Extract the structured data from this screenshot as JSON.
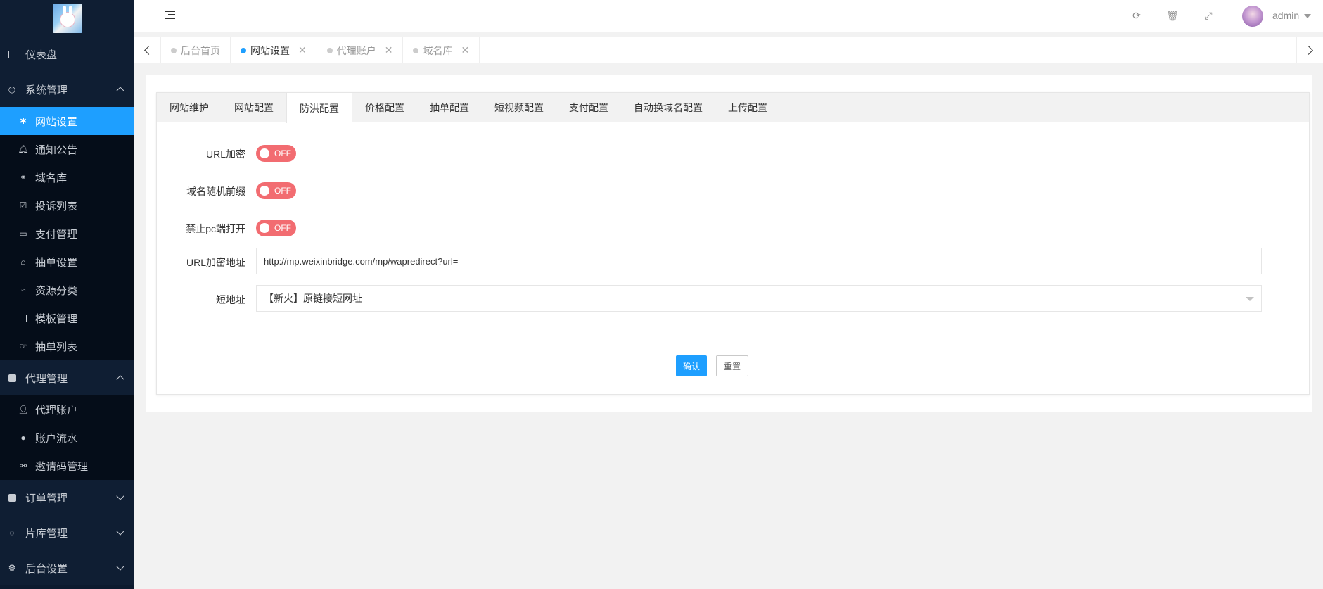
{
  "sidebar": {
    "logo_alt": "logo",
    "groups": [
      {
        "label": "仪表盘",
        "icon": "dashboard-icon",
        "children": []
      },
      {
        "label": "系统管理",
        "icon": "settings-icon",
        "expanded": true,
        "children": [
          {
            "label": "网站设置",
            "icon": "asterisk-icon",
            "active": true
          },
          {
            "label": "通知公告",
            "icon": "bell-icon"
          },
          {
            "label": "域名库",
            "icon": "link-icon"
          },
          {
            "label": "投诉列表",
            "icon": "checkbox-icon"
          },
          {
            "label": "支付管理",
            "icon": "credit-card-icon"
          },
          {
            "label": "抽单设置",
            "icon": "industry-icon"
          },
          {
            "label": "资源分类",
            "icon": "swimmer-icon"
          },
          {
            "label": "模板管理",
            "icon": "html5-icon"
          },
          {
            "label": "抽单列表",
            "icon": "hand-lizard-icon"
          }
        ]
      },
      {
        "label": "代理管理",
        "icon": "address-book-icon",
        "expanded": true,
        "children": [
          {
            "label": "代理账户",
            "icon": "user-icon"
          },
          {
            "label": "账户流水",
            "icon": "money-circle-icon"
          },
          {
            "label": "邀请码管理",
            "icon": "handshake-icon"
          }
        ]
      },
      {
        "label": "订单管理",
        "icon": "order-icon",
        "expanded": false,
        "children": []
      },
      {
        "label": "片库管理",
        "icon": "film-icon",
        "expanded": false,
        "children": []
      },
      {
        "label": "后台设置",
        "icon": "cogs-icon",
        "expanded": false,
        "children": []
      }
    ]
  },
  "header": {
    "user_name": "admin"
  },
  "page_tabs": [
    {
      "label": "后台首页",
      "active": false,
      "closable": false
    },
    {
      "label": "网站设置",
      "active": true,
      "closable": true
    },
    {
      "label": "代理账户",
      "active": false,
      "closable": true
    },
    {
      "label": "域名库",
      "active": false,
      "closable": true
    }
  ],
  "form_tabs": [
    "网站维护",
    "网站配置",
    "防洪配置",
    "价格配置",
    "抽单配置",
    "短视频配置",
    "支付配置",
    "自动换域名配置",
    "上传配置"
  ],
  "active_form_tab": "防洪配置",
  "form": {
    "url_encrypt": {
      "label": "URL加密",
      "state": "OFF"
    },
    "domain_random_prefix": {
      "label": "域名随机前缀",
      "state": "OFF"
    },
    "block_pc": {
      "label": "禁止pc端打开",
      "state": "OFF"
    },
    "url_encrypt_address": {
      "label": "URL加密地址",
      "value": "http://mp.weixinbridge.com/mp/wapredirect?url="
    },
    "short_url": {
      "label": "短地址",
      "selected": "【新火】原链接短网址"
    }
  },
  "buttons": {
    "confirm": "确认",
    "reset": "重置"
  },
  "colors": {
    "accent": "#1e9fff",
    "sidebar_bg": "#0c1a2e",
    "switch_off": "#f26c71"
  }
}
